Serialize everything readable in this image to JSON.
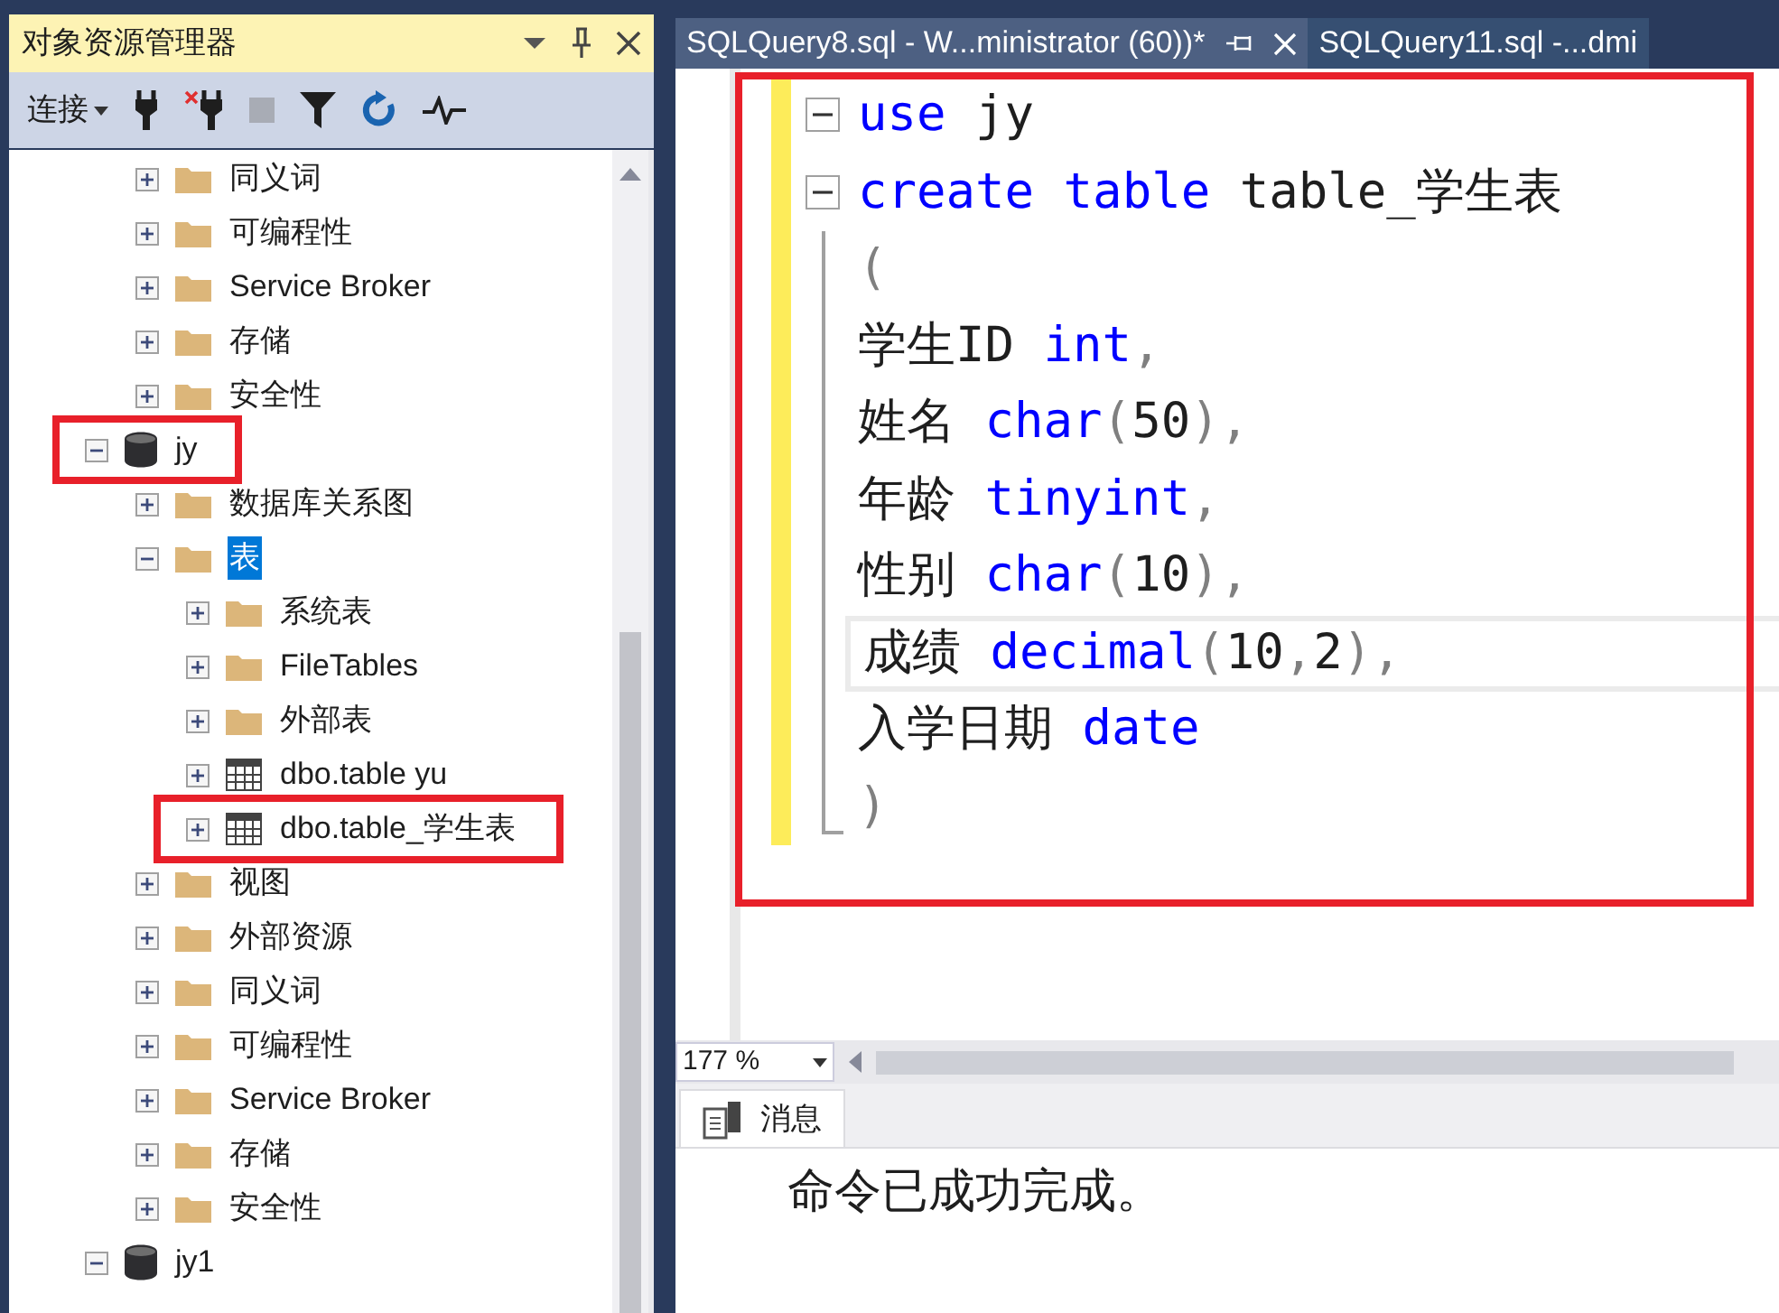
{
  "explorer": {
    "title": "对象资源管理器",
    "toolbar": {
      "connect": "连接"
    },
    "tree": [
      {
        "children": [
          {
            "label": "同义词",
            "kind": "folder",
            "expanded": false,
            "selected": false,
            "highlighted": false
          },
          {
            "label": "可编程性",
            "kind": "folder",
            "expanded": false,
            "selected": false,
            "highlighted": false
          },
          {
            "label": "Service Broker",
            "kind": "folder",
            "expanded": false,
            "selected": false,
            "highlighted": false
          },
          {
            "label": "存储",
            "kind": "folder",
            "expanded": false,
            "selected": false,
            "highlighted": false
          },
          {
            "label": "安全性",
            "kind": "folder",
            "expanded": false,
            "selected": false,
            "highlighted": false
          }
        ]
      },
      {
        "label": "jy",
        "kind": "database",
        "expanded": true,
        "selected": false,
        "highlighted": true,
        "children": [
          {
            "label": "数据库关系图",
            "kind": "folder",
            "expanded": false,
            "selected": false,
            "highlighted": false
          },
          {
            "label": "表",
            "kind": "folder",
            "expanded": true,
            "selected": true,
            "highlighted": false,
            "children": [
              {
                "label": "系统表",
                "kind": "folder",
                "expanded": false,
                "selected": false,
                "highlighted": false
              },
              {
                "label": "FileTables",
                "kind": "folder",
                "expanded": false,
                "selected": false,
                "highlighted": false
              },
              {
                "label": "外部表",
                "kind": "folder",
                "expanded": false,
                "selected": false,
                "highlighted": false
              },
              {
                "label": "dbo.table yu",
                "kind": "table",
                "expanded": false,
                "selected": false,
                "highlighted": false
              },
              {
                "label": "dbo.table_学生表",
                "kind": "table",
                "expanded": false,
                "selected": false,
                "highlighted": true
              }
            ]
          },
          {
            "label": "视图",
            "kind": "folder",
            "expanded": false,
            "selected": false,
            "highlighted": false
          },
          {
            "label": "外部资源",
            "kind": "folder",
            "expanded": false,
            "selected": false,
            "highlighted": false
          },
          {
            "label": "同义词",
            "kind": "folder",
            "expanded": false,
            "selected": false,
            "highlighted": false
          },
          {
            "label": "可编程性",
            "kind": "folder",
            "expanded": false,
            "selected": false,
            "highlighted": false
          },
          {
            "label": "Service Broker",
            "kind": "folder",
            "expanded": false,
            "selected": false,
            "highlighted": false
          },
          {
            "label": "存储",
            "kind": "folder",
            "expanded": false,
            "selected": false,
            "highlighted": false
          },
          {
            "label": "安全性",
            "kind": "folder",
            "expanded": false,
            "selected": false,
            "highlighted": false
          }
        ]
      },
      {
        "label": "jy1",
        "kind": "database",
        "expanded": true,
        "selected": false,
        "highlighted": false
      }
    ]
  },
  "tabs": [
    {
      "label": "SQLQuery8.sql - W...ministrator (60))*",
      "selected": true
    },
    {
      "label": "SQLQuery11.sql -...dmi",
      "selected": false
    }
  ],
  "editor": {
    "highlighted": true,
    "lines": [
      {
        "kind": "start",
        "current": false,
        "tokens": [
          {
            "text": "use",
            "kind": "keyword"
          },
          {
            "text": " jy",
            "kind": "plain"
          }
        ]
      },
      {
        "kind": "start",
        "current": false,
        "tokens": [
          {
            "text": "create",
            "kind": "keyword"
          },
          {
            "text": " table",
            "kind": "keyword"
          },
          {
            "text": " table_学生表",
            "kind": "plain"
          }
        ]
      },
      {
        "kind": "line",
        "current": false,
        "tokens": [
          {
            "text": "(",
            "kind": "punct"
          }
        ]
      },
      {
        "kind": "line",
        "current": false,
        "tokens": [
          {
            "text": "学生ID ",
            "kind": "plain"
          },
          {
            "text": "int",
            "kind": "keyword"
          },
          {
            "text": ",",
            "kind": "punct"
          }
        ]
      },
      {
        "kind": "line",
        "current": false,
        "tokens": [
          {
            "text": "姓名 ",
            "kind": "plain"
          },
          {
            "text": "char",
            "kind": "keyword"
          },
          {
            "text": "(",
            "kind": "punct"
          },
          {
            "text": "50",
            "kind": "plain"
          },
          {
            "text": "),",
            "kind": "punct"
          }
        ]
      },
      {
        "kind": "line",
        "current": false,
        "tokens": [
          {
            "text": "年龄 ",
            "kind": "plain"
          },
          {
            "text": "tinyint",
            "kind": "keyword"
          },
          {
            "text": ",",
            "kind": "punct"
          }
        ]
      },
      {
        "kind": "line",
        "current": false,
        "tokens": [
          {
            "text": "性别 ",
            "kind": "plain"
          },
          {
            "text": "char",
            "kind": "keyword"
          },
          {
            "text": "(",
            "kind": "punct"
          },
          {
            "text": "10",
            "kind": "plain"
          },
          {
            "text": "),",
            "kind": "punct"
          }
        ]
      },
      {
        "kind": "line",
        "current": true,
        "tokens": [
          {
            "text": "成绩 ",
            "kind": "plain"
          },
          {
            "text": "decimal",
            "kind": "keyword"
          },
          {
            "text": "(",
            "kind": "punct"
          },
          {
            "text": "10",
            "kind": "plain"
          },
          {
            "text": ",",
            "kind": "punct"
          },
          {
            "text": "2",
            "kind": "plain"
          },
          {
            "text": "),",
            "kind": "punct"
          }
        ]
      },
      {
        "kind": "line",
        "current": false,
        "tokens": [
          {
            "text": "入学日期 ",
            "kind": "plain"
          },
          {
            "text": "date",
            "kind": "keyword"
          }
        ]
      },
      {
        "kind": "end",
        "current": false,
        "tokens": [
          {
            "text": ")",
            "kind": "punct"
          }
        ]
      }
    ],
    "zoom": "177 %"
  },
  "results": {
    "tabs": [
      {
        "label": "消息",
        "selected": true
      }
    ],
    "message": "命令已成功完成。"
  }
}
